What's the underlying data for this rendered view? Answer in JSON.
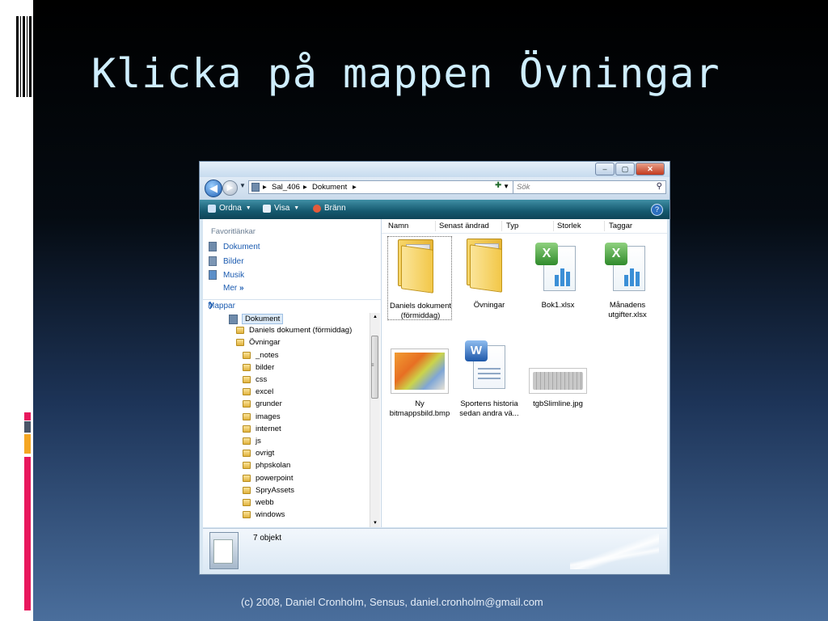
{
  "slide": {
    "title": "Klicka på mappen Övningar",
    "footer": "(c) 2008, Daniel Cronholm, Sensus, daniel.cronholm@gmail.com",
    "accent_colors": [
      "#e8175d",
      "#4a5568",
      "#f5a623",
      "#e8175d"
    ]
  },
  "window": {
    "buttons": {
      "minimize": "–",
      "maximize": "▢",
      "close": "✕"
    },
    "address": {
      "crumbs": [
        "Sal_406",
        "Dokument"
      ]
    },
    "search": {
      "placeholder": "Sök"
    },
    "toolbar": {
      "organize": "Ordna",
      "view": "Visa",
      "burn": "Bränn",
      "help": "?"
    },
    "left_pane": {
      "favorites_title": "Favoritlänkar",
      "favorites": [
        "Dokument",
        "Bilder",
        "Musik"
      ],
      "more": "Mer",
      "folders_title": "Mappar",
      "tree": [
        {
          "label": "Dokument",
          "level": 0,
          "selected": true
        },
        {
          "label": "Daniels dokument (förmiddag)",
          "level": 1
        },
        {
          "label": "Övningar",
          "level": 1
        },
        {
          "label": "_notes",
          "level": 2
        },
        {
          "label": "bilder",
          "level": 2
        },
        {
          "label": "css",
          "level": 2
        },
        {
          "label": "excel",
          "level": 2
        },
        {
          "label": "grunder",
          "level": 2
        },
        {
          "label": "images",
          "level": 2
        },
        {
          "label": "internet",
          "level": 2
        },
        {
          "label": "js",
          "level": 2
        },
        {
          "label": "ovrigt",
          "level": 2
        },
        {
          "label": "phpskolan",
          "level": 2
        },
        {
          "label": "powerpoint",
          "level": 2
        },
        {
          "label": "SpryAssets",
          "level": 2
        },
        {
          "label": "webb",
          "level": 2
        },
        {
          "label": "windows",
          "level": 2
        }
      ]
    },
    "columns": [
      "Namn",
      "Senast ändrad",
      "Typ",
      "Storlek",
      "Taggar"
    ],
    "files": [
      {
        "name_line1": "Daniels dokument",
        "name_line2": "(förmiddag)",
        "icon": "folder-icon",
        "selected": true
      },
      {
        "name_line1": "Övningar",
        "name_line2": "",
        "icon": "folder-icon"
      },
      {
        "name_line1": "Bok1.xlsx",
        "name_line2": "",
        "icon": "excel-icon"
      },
      {
        "name_line1": "Månadens",
        "name_line2": "utgifter.xlsx",
        "icon": "excel-icon"
      },
      {
        "name_line1": "Ny",
        "name_line2": "bitmappsbild.bmp",
        "icon": "bitmap-icon"
      },
      {
        "name_line1": "Sportens historia",
        "name_line2": "sedan andra vä...",
        "icon": "word-icon"
      },
      {
        "name_line1": "tgbSlimline.jpg",
        "name_line2": "",
        "icon": "keyboard-image-icon"
      }
    ],
    "status": {
      "count": "7 objekt"
    }
  }
}
